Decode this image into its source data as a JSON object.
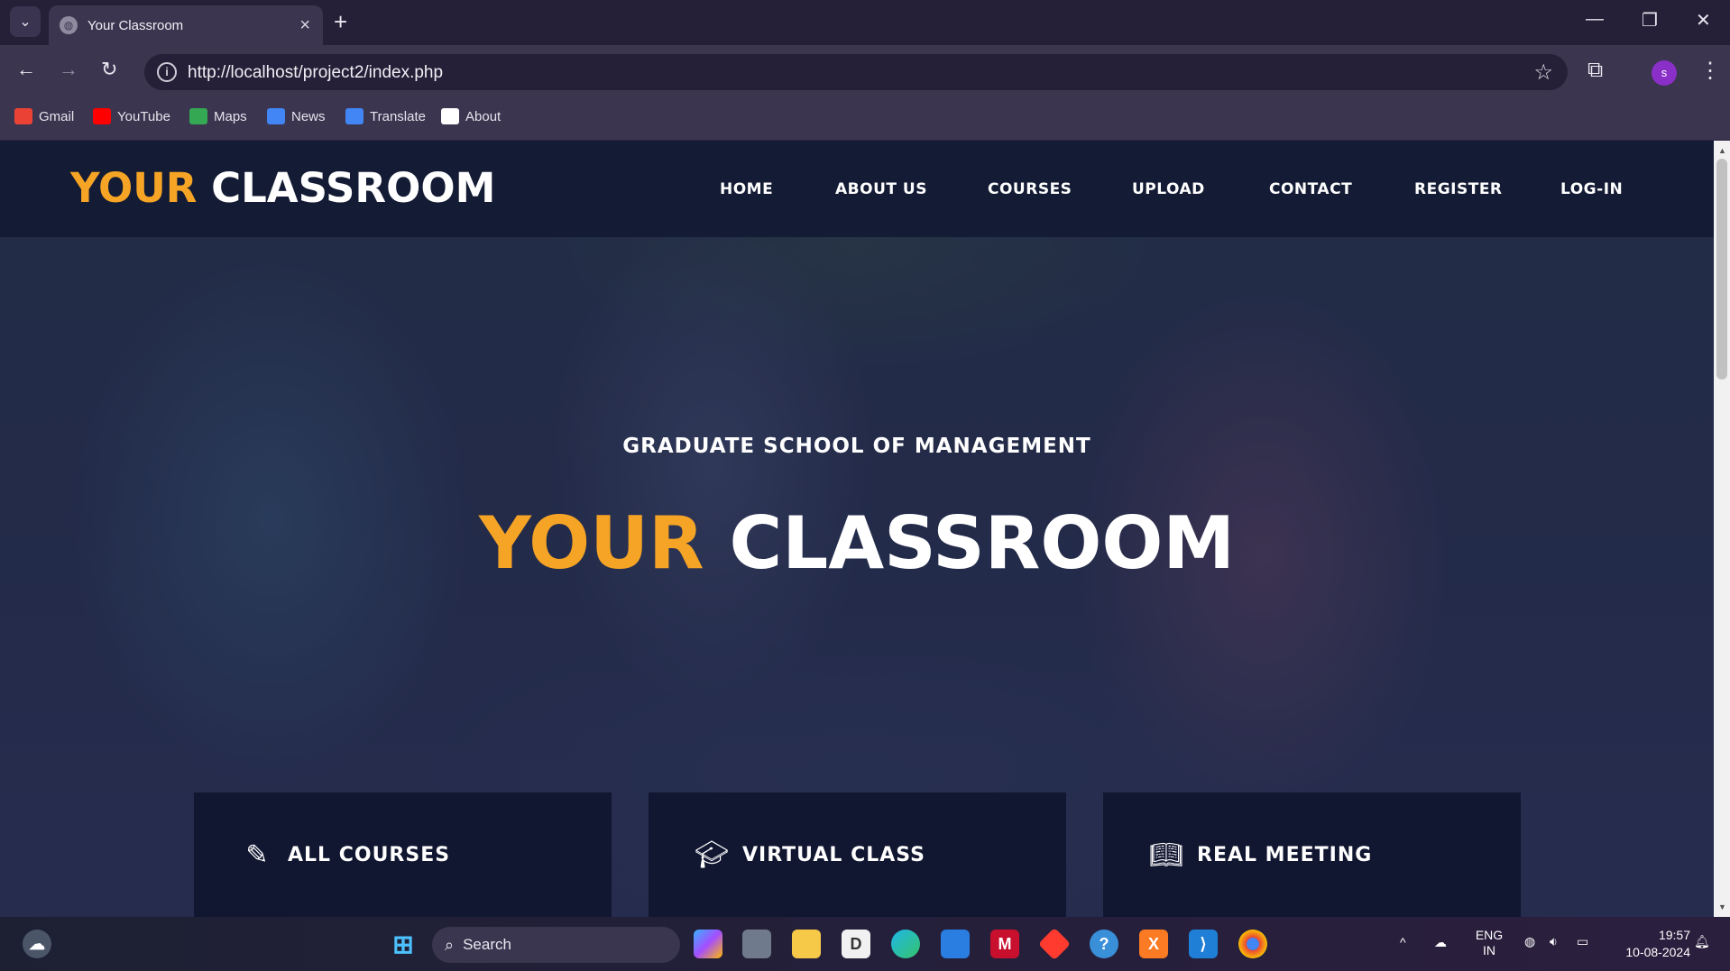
{
  "browser": {
    "tab_title": "Your Classroom",
    "url": "http://localhost/project2/index.php",
    "profile_initial": "s",
    "bookmarks": [
      {
        "label": "Gmail",
        "icon": "gmail-icon",
        "color": "#ea4335"
      },
      {
        "label": "YouTube",
        "icon": "youtube-icon",
        "color": "#ff0000"
      },
      {
        "label": "Maps",
        "icon": "maps-icon",
        "color": "#34a853"
      },
      {
        "label": "News",
        "icon": "news-icon",
        "color": "#4285f4"
      },
      {
        "label": "Translate",
        "icon": "translate-icon",
        "color": "#4285f4"
      },
      {
        "label": "About",
        "icon": "about-icon",
        "color": "#ffffff"
      }
    ]
  },
  "site": {
    "logo": {
      "first": "YOUR",
      "second": "CLASSROOM"
    },
    "nav": [
      "HOME",
      "ABOUT US",
      "COURSES",
      "UPLOAD",
      "CONTACT",
      "REGISTER",
      "LOG-IN"
    ],
    "hero": {
      "subtitle": "GRADUATE SCHOOL OF MANAGEMENT",
      "title_first": "YOUR",
      "title_second": "CLASSROOM"
    },
    "features": [
      {
        "label": "ALL COURSES",
        "icon": "pencil-icon"
      },
      {
        "label": "VIRTUAL CLASS",
        "icon": "graduation-cap-icon"
      },
      {
        "label": "REAL MEETING",
        "icon": "book-icon"
      }
    ],
    "colors": {
      "accent": "#f5a425",
      "nav_bg": "#141b34",
      "feature_bg": "#111631"
    }
  },
  "taskbar": {
    "search_label": "Search",
    "language": "ENG",
    "region": "IN",
    "time": "19:57",
    "date": "10-08-2024"
  }
}
